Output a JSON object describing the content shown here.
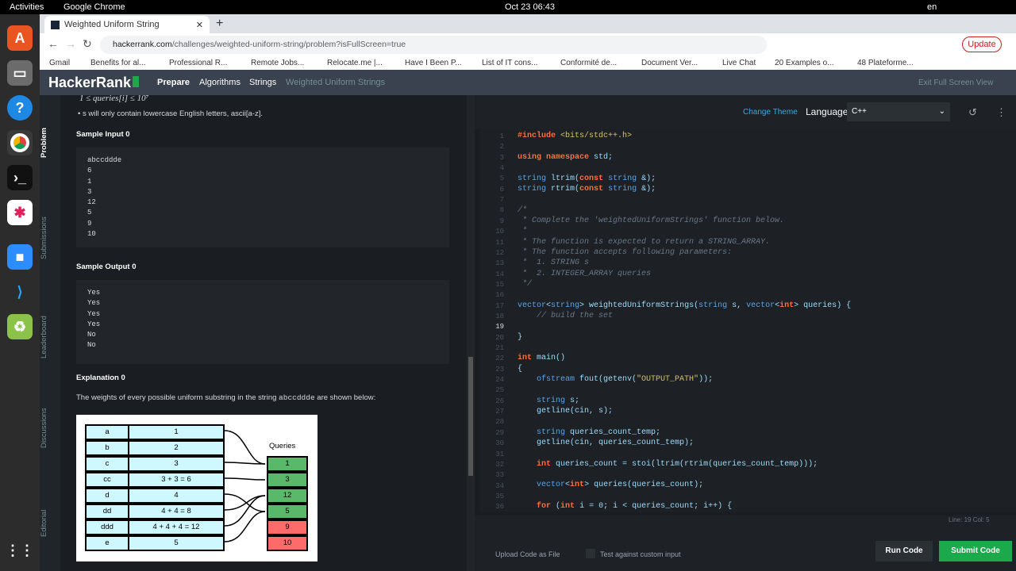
{
  "os": {
    "activities": "Activities",
    "app": "Google Chrome",
    "clock": "Oct 23  06:43",
    "lang": "en"
  },
  "browser": {
    "tab_title": "Weighted Uniform String",
    "new_tab": "+",
    "url_domain": "hackerrank.com",
    "url_path": "/challenges/weighted-uniform-string/problem?isFullScreen=true",
    "update_label": "Update",
    "bookmarks": [
      "Gmail",
      "Benefits for al...",
      "Professional R...",
      "Remote Jobs...",
      "Relocate.me |...",
      "Have I Been P...",
      "List of IT cons...",
      "Conformité de...",
      "Document Ver...",
      "Live Chat",
      "20 Examples o...",
      "48 Plateforme..."
    ]
  },
  "header": {
    "logo": "HackerRank",
    "crumbs": [
      "Prepare",
      "Algorithms",
      "Strings",
      "Weighted Uniform Strings"
    ],
    "exit": "Exit Full Screen View"
  },
  "side_tabs": [
    "Problem",
    "Submissions",
    "Leaderboard",
    "Discussions",
    "Editorial"
  ],
  "problem": {
    "constraint1": "1 ≤ queries[i] ≤ 10⁷",
    "constraint2": "s will only contain lowercase English letters, ascii[a-z].",
    "sample_input_title": "Sample Input 0",
    "sample_input": "abccddde\n6\n1\n3\n12\n5\n9\n10",
    "sample_output_title": "Sample Output 0",
    "sample_output": "Yes\nYes\nYes\nYes\nNo\nNo",
    "explanation_title": "Explanation 0",
    "explanation_pre": "The weights of every possible uniform substring in the string ",
    "explanation_code": "abccddde",
    "explanation_post": " are shown below:",
    "figure": {
      "queries_label": "Queries",
      "letters": [
        "a",
        "b",
        "c",
        "cc",
        "d",
        "dd",
        "ddd",
        "e"
      ],
      "weights": [
        "1",
        "2",
        "3",
        "3 + 3 = 6",
        "4",
        "4 + 4 = 8",
        "4 + 4 + 4 = 12",
        "5"
      ],
      "queries": [
        "1",
        "3",
        "12",
        "5",
        "9",
        "10"
      ],
      "query_status": [
        "yes",
        "yes",
        "yes",
        "yes",
        "no",
        "no"
      ]
    }
  },
  "editor": {
    "change_theme": "Change Theme",
    "language_label": "Language",
    "language": "C++",
    "status": "Line: 19  Col: 5",
    "upload": "Upload Code as File",
    "test_custom": "Test against custom input",
    "run": "Run Code",
    "submit": "Submit Code",
    "line_numbers": [
      "1",
      "2",
      "3",
      "4",
      "5",
      "6",
      "7",
      "8",
      "9",
      "10",
      "11",
      "12",
      "13",
      "14",
      "15",
      "16",
      "17",
      "18",
      "19",
      "20",
      "21",
      "22",
      "23",
      "24",
      "25",
      "26",
      "27",
      "28",
      "29",
      "30",
      "31",
      "32",
      "33",
      "34",
      "35",
      "36"
    ]
  }
}
